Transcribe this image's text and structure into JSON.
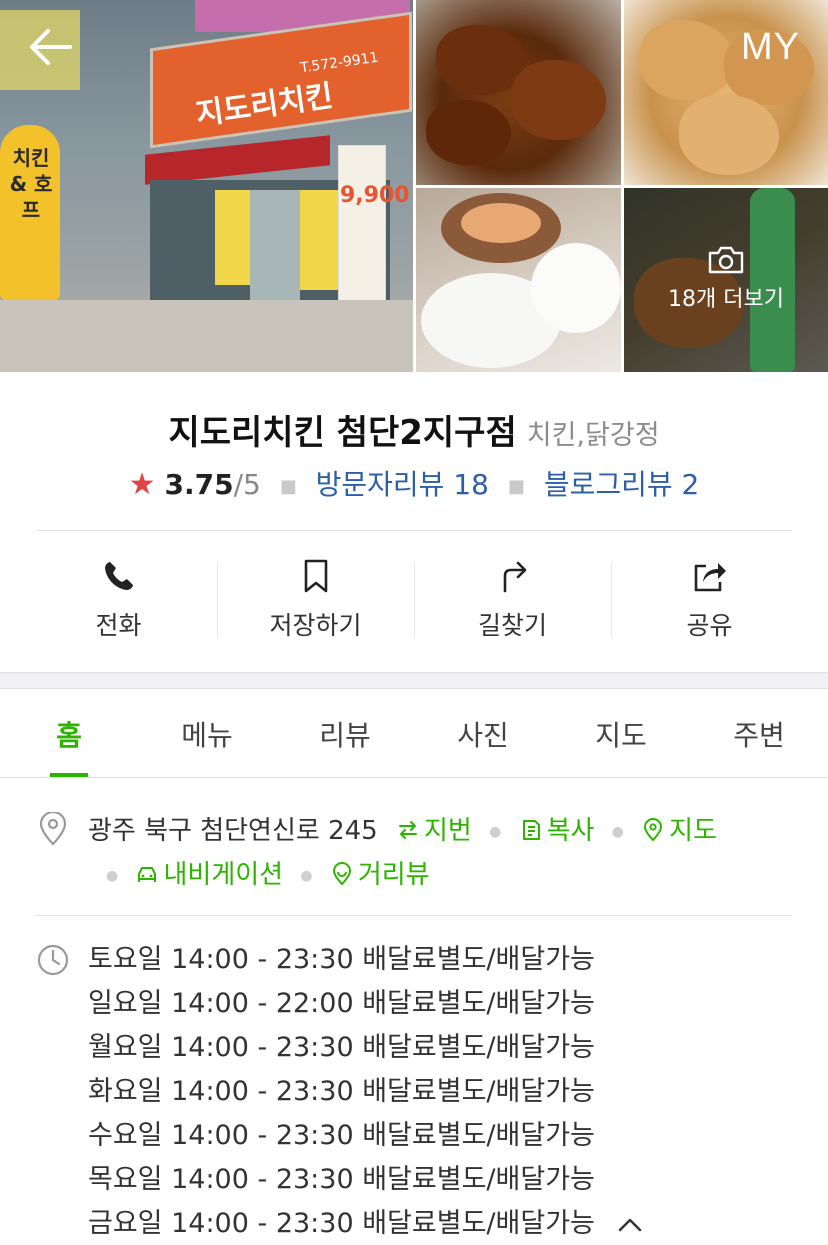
{
  "header": {
    "back_icon": "arrow-left-icon",
    "my_label": "MY",
    "more_photos_label": "18개 더보기"
  },
  "store": {
    "name": "지도리치킨 첨단2지구점",
    "category": "치킨,닭강정",
    "rating_star": "★",
    "rating": "3.75",
    "rating_max": "/5",
    "visitor_reviews": "방문자리뷰 18",
    "blog_reviews": "블로그리뷰 2"
  },
  "actions": [
    {
      "label": "전화",
      "icon": "phone-icon"
    },
    {
      "label": "저장하기",
      "icon": "bookmark-icon"
    },
    {
      "label": "길찾기",
      "icon": "directions-icon"
    },
    {
      "label": "공유",
      "icon": "share-icon"
    }
  ],
  "tabs": [
    "홈",
    "메뉴",
    "리뷰",
    "사진",
    "지도",
    "주변"
  ],
  "active_tab": "홈",
  "address": {
    "text": "광주 북구 첨단연신로 245",
    "lot_label": "지번",
    "copy_label": "복사",
    "map_label": "지도",
    "navigation_label": "내비게이션",
    "street_view_label": "거리뷰"
  },
  "hours": [
    "토요일 14:00 - 23:30 배달료별도/배달가능",
    "일요일 14:00 - 22:00 배달료별도/배달가능",
    "월요일 14:00 - 23:30 배달료별도/배달가능",
    "화요일 14:00 - 23:30 배달료별도/배달가능",
    "수요일 14:00 - 23:30 배달료별도/배달가능",
    "목요일 14:00 - 23:30 배달료별도/배달가능",
    "금요일 14:00 - 23:30 배달료별도/배달가능"
  ],
  "storefront_signs": {
    "sign_name": "지도리치킨",
    "sign_phone": "T.572-9911",
    "banner_price": "9,900",
    "balloon_text": "치킨 & 호프"
  },
  "colors": {
    "accent_green": "#2db400",
    "link_blue": "#2d5fa6",
    "star_red": "#e04444"
  }
}
